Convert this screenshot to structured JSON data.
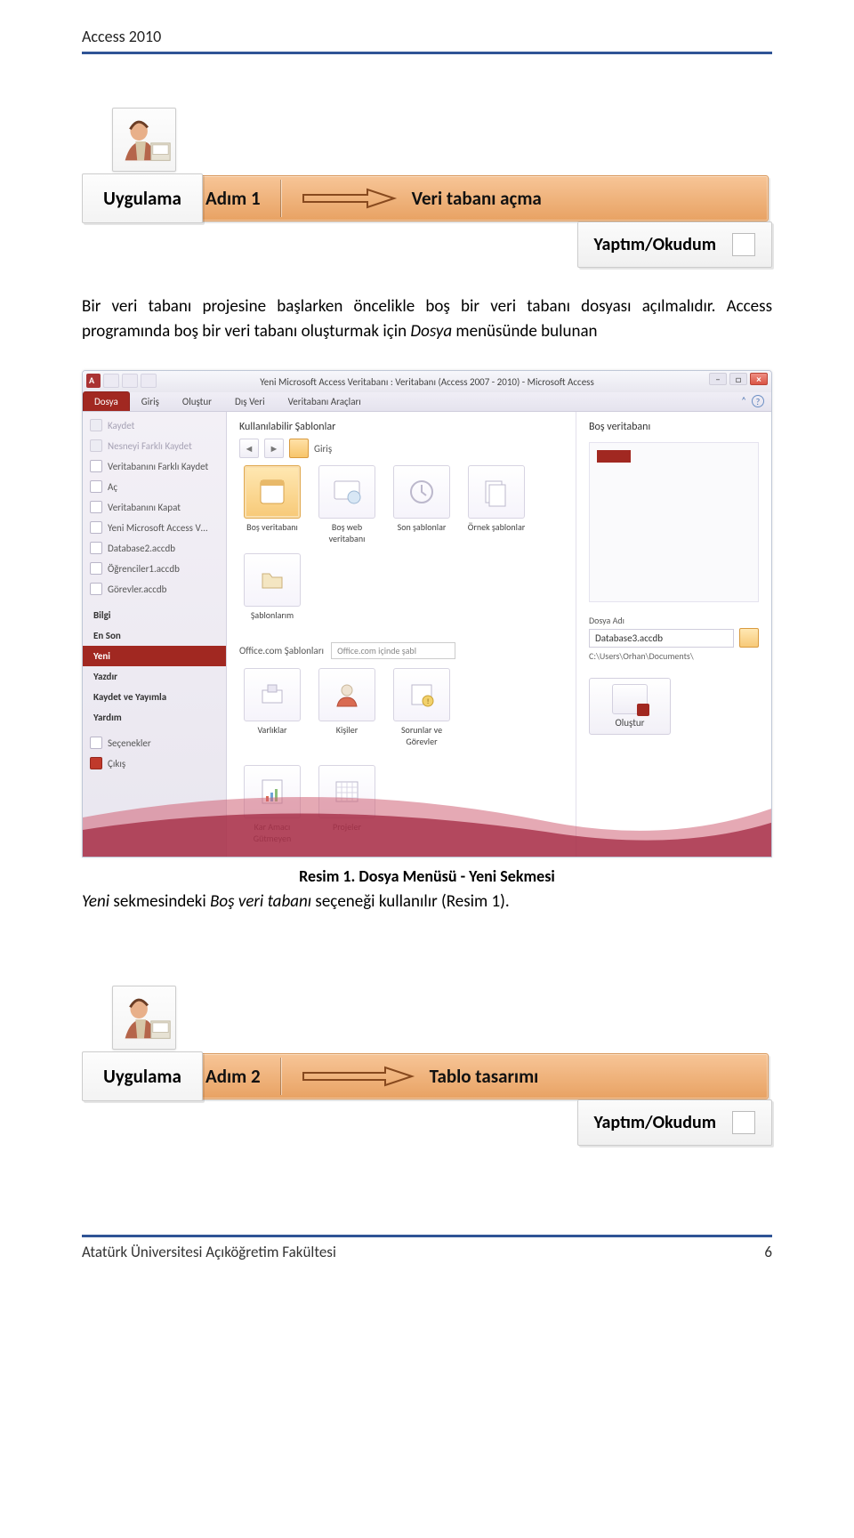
{
  "header": {
    "title": "Access 2010"
  },
  "footer": {
    "left": "Atatürk Üniversitesi Açıköğretim Fakültesi",
    "page": "6"
  },
  "step1": {
    "uygulama": "Uygulama",
    "adim": "Adım 1",
    "title": "Veri tabanı açma",
    "yaptim": "Yaptım/Okudum"
  },
  "para1": {
    "t1": "Bir veri tabanı projesine başlarken öncelikle boş bir veri tabanı dosyası açılmalıdır. Access programında boş bir veri tabanı oluşturmak için ",
    "em1": "Dosya",
    "t2": " menüsünde bulunan"
  },
  "caption1": {
    "label": "Resim 1.",
    "text": " Dosya Menüsü - Yeni Sekmesi"
  },
  "para2": {
    "em1": "Yeni",
    "t1": " sekmesindeki ",
    "em2": "Boş veri tabanı",
    "t2": " seçeneği kullanılır (Resim 1)."
  },
  "step2": {
    "uygulama": "Uygulama",
    "adim": "Adım 2",
    "title": "Tablo tasarımı",
    "yaptim": "Yaptım/Okudum"
  },
  "access": {
    "window_title": "Yeni Microsoft Access Veritabanı : Veritabanı (Access 2007 - 2010) - Microsoft Access",
    "ribbon_tabs": [
      "Dosya",
      "Giriş",
      "Oluştur",
      "Dış Veri",
      "Veritabanı Araçları"
    ],
    "sidebar": {
      "top": [
        {
          "label": "Kaydet",
          "state": "disabled"
        },
        {
          "label": "Nesneyi Farklı Kaydet",
          "state": "disabled"
        },
        {
          "label": "Veritabanını Farklı Kaydet",
          "state": "normal"
        },
        {
          "label": "Aç",
          "state": "normal"
        },
        {
          "label": "Veritabanını Kapat",
          "state": "normal"
        },
        {
          "label": "Yeni Microsoft Access V…",
          "state": "normal"
        },
        {
          "label": "Database2.accdb",
          "state": "normal"
        },
        {
          "label": "Öğrenciler1.accdb",
          "state": "normal"
        },
        {
          "label": "Görevler.accdb",
          "state": "normal"
        }
      ],
      "mid": [
        {
          "label": "Bilgi"
        },
        {
          "label": "En Son"
        },
        {
          "label": "Yeni",
          "selected": true
        },
        {
          "label": "Yazdır"
        },
        {
          "label": "Kaydet ve Yayımla"
        },
        {
          "label": "Yardım"
        }
      ],
      "bottom": [
        {
          "label": "Seçenekler"
        },
        {
          "label": "Çıkış",
          "red": true
        }
      ]
    },
    "templates": {
      "title": "Kullanılabilir Şablonlar",
      "crumb": "Giriş",
      "row1": [
        {
          "label": "Boş veritabanı",
          "selected": true
        },
        {
          "label": "Boş web veritabanı"
        },
        {
          "label": "Son şablonlar"
        }
      ],
      "row2": [
        {
          "label": "Örnek şablonlar"
        },
        {
          "label": "Şablonlarım"
        }
      ],
      "officecom_label": "Office.com Şablonları",
      "officecom_search": "Office.com içinde şabl",
      "row3": [
        {
          "label": "Varlıklar"
        },
        {
          "label": "Kişiler"
        },
        {
          "label": "Sorunlar ve Görevler"
        }
      ],
      "row4": [
        {
          "label": "Kar Amacı Gütmeyen"
        },
        {
          "label": "Projeler"
        }
      ]
    },
    "right": {
      "title": "Boş veritabanı",
      "field_label": "Dosya Adı",
      "file_name": "Database3.accdb",
      "path": "C:\\Users\\Orhan\\Documents\\",
      "create": "Oluştur"
    }
  }
}
